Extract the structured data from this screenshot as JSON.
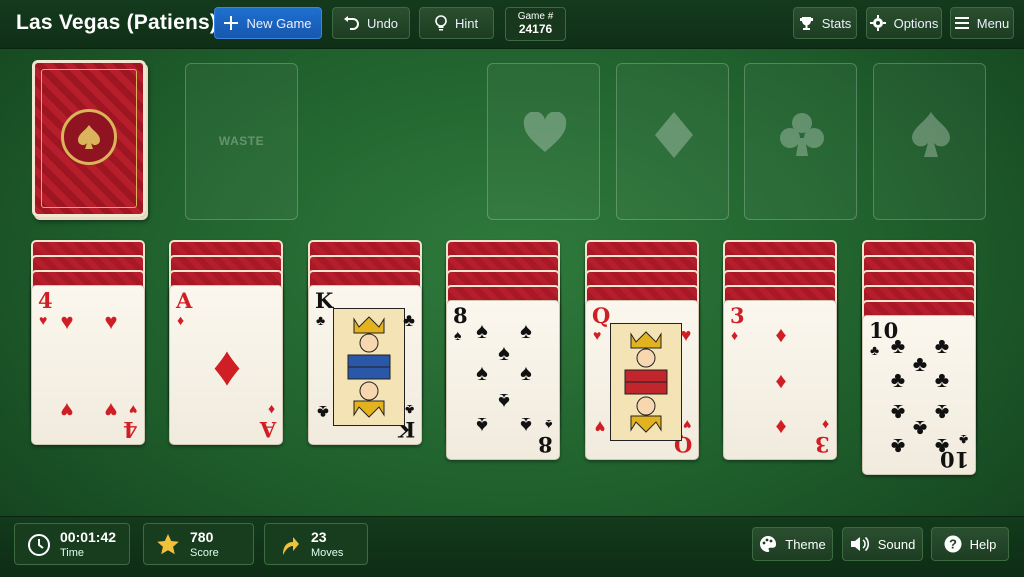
{
  "app": {
    "title": "Las Vegas (Patiens)"
  },
  "toolbar": {
    "new_game": "New Game",
    "undo": "Undo",
    "hint": "Hint",
    "game_label": "Game #",
    "game_number": "24176",
    "stats": "Stats",
    "options": "Options",
    "menu": "Menu"
  },
  "board": {
    "waste_label": "WASTE",
    "foundations": [
      "hearts-icon",
      "diamonds-icon",
      "clubs-icon",
      "spades-icon"
    ],
    "tableau": [
      {
        "rank": "4",
        "suit": "♥",
        "color": "red",
        "hidden": 3
      },
      {
        "rank": "A",
        "suit": "♦",
        "color": "red",
        "hidden": 3
      },
      {
        "rank": "K",
        "suit": "♣",
        "color": "black",
        "hidden": 3
      },
      {
        "rank": "8",
        "suit": "♠",
        "color": "black",
        "hidden": 4
      },
      {
        "rank": "Q",
        "suit": "♥",
        "color": "red",
        "hidden": 4
      },
      {
        "rank": "3",
        "suit": "♦",
        "color": "red",
        "hidden": 4
      },
      {
        "rank": "10",
        "suit": "♣",
        "color": "black",
        "hidden": 5
      }
    ]
  },
  "status": {
    "time_value": "00:01:42",
    "time_label": "Time",
    "score_value": "780",
    "score_label": "Score",
    "moves_value": "23",
    "moves_label": "Moves"
  },
  "footer": {
    "theme": "Theme",
    "sound": "Sound",
    "help": "Help"
  },
  "colors": {
    "felt": "#1f5f2c",
    "accent": "#1f6fd0",
    "card_red": "#d01f24",
    "card_back": "#b51e2a"
  }
}
